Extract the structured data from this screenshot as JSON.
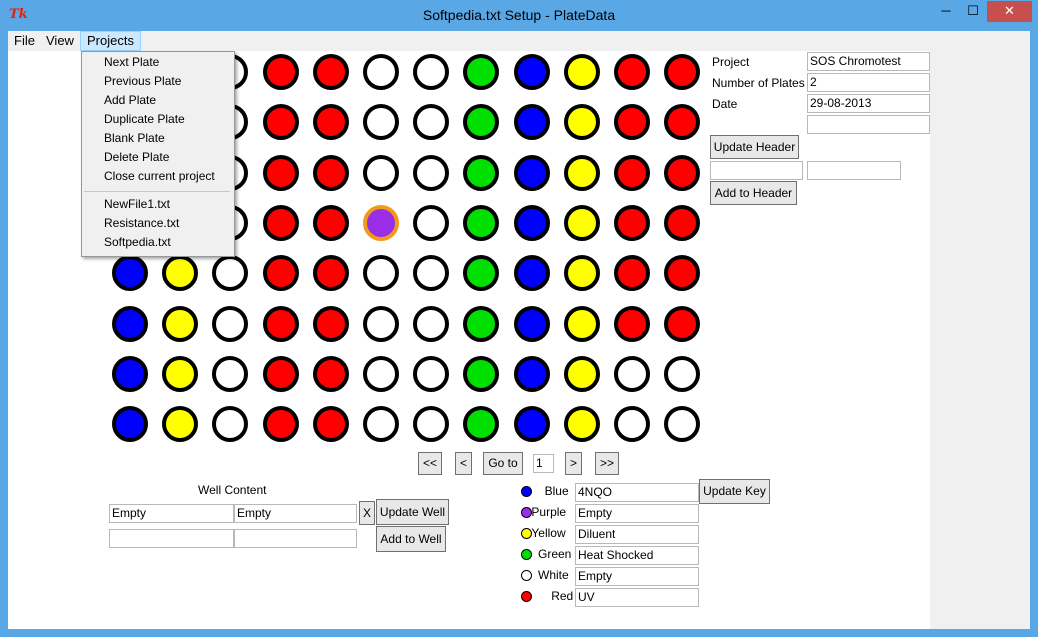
{
  "window": {
    "title": "Softpedia.txt Setup - PlateData",
    "icon": "tk-icon",
    "minimize": "─",
    "maximize": "☐",
    "close": "✕"
  },
  "menubar": {
    "file": "File",
    "view": "View",
    "projects": "Projects"
  },
  "projects_menu": {
    "items": [
      "Next Plate",
      "Previous Plate",
      "Add Plate",
      "Duplicate Plate",
      "Blank Plate",
      "Delete Plate",
      "Close current project"
    ],
    "recent": [
      "NewFile1.txt",
      "Resistance.txt",
      "Softpedia.txt"
    ]
  },
  "colors": {
    "blue": "#0000ff",
    "yellow": "#ffff00",
    "white": "#ffffff",
    "red": "#ff0000",
    "green": "#00e000",
    "purple": "#9a2ee8",
    "highlight": "#f29b18"
  },
  "plate": {
    "rows": [
      [
        "blue",
        "yellow",
        "white",
        "red",
        "red",
        "white",
        "white",
        "green",
        "blue",
        "yellow",
        "red",
        "red"
      ],
      [
        "blue",
        "yellow",
        "white",
        "red",
        "red",
        "white",
        "white",
        "green",
        "blue",
        "yellow",
        "red",
        "red"
      ],
      [
        "blue",
        "yellow",
        "white",
        "red",
        "red",
        "white",
        "white",
        "green",
        "blue",
        "yellow",
        "red",
        "red"
      ],
      [
        "blue",
        "yellow",
        "white",
        "red",
        "red",
        "purple",
        "white",
        "green",
        "blue",
        "yellow",
        "red",
        "red"
      ],
      [
        "blue",
        "yellow",
        "white",
        "red",
        "red",
        "white",
        "white",
        "green",
        "blue",
        "yellow",
        "red",
        "red"
      ],
      [
        "blue",
        "yellow",
        "white",
        "red",
        "red",
        "white",
        "white",
        "green",
        "blue",
        "yellow",
        "red",
        "red"
      ],
      [
        "blue",
        "yellow",
        "white",
        "red",
        "red",
        "white",
        "white",
        "green",
        "blue",
        "yellow",
        "white",
        "white"
      ],
      [
        "blue",
        "yellow",
        "white",
        "red",
        "red",
        "white",
        "white",
        "green",
        "blue",
        "yellow",
        "white",
        "white"
      ]
    ],
    "selected_well": {
      "row": 4,
      "col": 6
    }
  },
  "header": {
    "project_label": "Project",
    "project_value": "SOS Chromotest",
    "plates_label": "Number of Plates",
    "plates_value": "2",
    "date_label": "Date",
    "date_value": "29-08-2013",
    "extra_value": "",
    "update_header": "Update Header",
    "new_key": "",
    "new_value": "",
    "add_to_header": "Add to Header"
  },
  "nav": {
    "first": "<<",
    "prev": "<",
    "goto": "Go to",
    "page": "1",
    "next": ">",
    "last": ">>"
  },
  "well_content": {
    "heading": "Well Content",
    "key": "Empty",
    "value": "Empty",
    "clear": "X",
    "update_well": "Update Well",
    "new_key": "",
    "new_value": "",
    "add_to_well": "Add to Well"
  },
  "key": {
    "entries": [
      {
        "name": "Blue",
        "color": "blue",
        "value": "4NQO"
      },
      {
        "name": "Purple",
        "color": "purple",
        "value": "Empty"
      },
      {
        "name": "Yellow",
        "color": "yellow",
        "value": "Diluent"
      },
      {
        "name": "Green",
        "color": "green",
        "value": "Heat Shocked"
      },
      {
        "name": "White",
        "color": "white",
        "value": "Empty"
      },
      {
        "name": "Red",
        "color": "red",
        "value": "UV"
      }
    ],
    "update_key": "Update Key"
  }
}
